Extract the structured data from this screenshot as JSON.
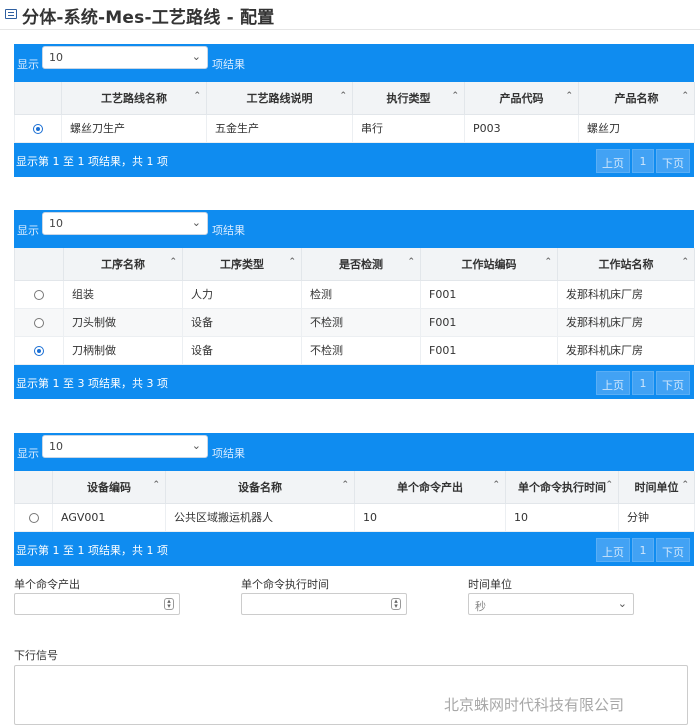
{
  "page": {
    "title": "分体-系统-Mes-工艺路线 - 配置",
    "watermark": "北京蛛网时代科技有限公司"
  },
  "pager": {
    "show": "显示",
    "result_label": "项结果",
    "prev": "上页",
    "next": "下页"
  },
  "table1": {
    "page_size": "10",
    "columns": [
      "工艺路线名称",
      "工艺路线说明",
      "执行类型",
      "产品代码",
      "产品名称"
    ],
    "rows": [
      {
        "selected": true,
        "cells": [
          "螺丝刀生产",
          "五金生产",
          "串行",
          "P003",
          "螺丝刀"
        ]
      }
    ],
    "info": "显示第 1 至 1 项结果，共 1 项",
    "page": "1"
  },
  "table2": {
    "page_size": "10",
    "columns": [
      "工序名称",
      "工序类型",
      "是否检测",
      "工作站编码",
      "工作站名称"
    ],
    "rows": [
      {
        "selected": false,
        "cells": [
          "组装",
          "人力",
          "检测",
          "F001",
          "发那科机床厂房"
        ]
      },
      {
        "selected": false,
        "cells": [
          "刀头制做",
          "设备",
          "不检测",
          "F001",
          "发那科机床厂房"
        ]
      },
      {
        "selected": true,
        "cells": [
          "刀柄制做",
          "设备",
          "不检测",
          "F001",
          "发那科机床厂房"
        ]
      }
    ],
    "info": "显示第 1 至 3 项结果，共 3 项",
    "page": "1"
  },
  "table3": {
    "page_size": "10",
    "columns": [
      "设备编码",
      "设备名称",
      "单个命令产出",
      "单个命令执行时间",
      "时间单位"
    ],
    "rows": [
      {
        "selected": false,
        "cells": [
          "AGV001",
          "公共区域搬运机器人",
          "10",
          "10",
          "分钟"
        ]
      }
    ],
    "info": "显示第 1 至 1 项结果，共 1 项",
    "page": "1"
  },
  "form": {
    "output_label": "单个命令产出",
    "output_value": "",
    "exec_time_label": "单个命令执行时间",
    "exec_time_value": "",
    "time_unit_label": "时间单位",
    "time_unit_value": "秒",
    "signal_label": "下行信号",
    "signal_value": ""
  }
}
